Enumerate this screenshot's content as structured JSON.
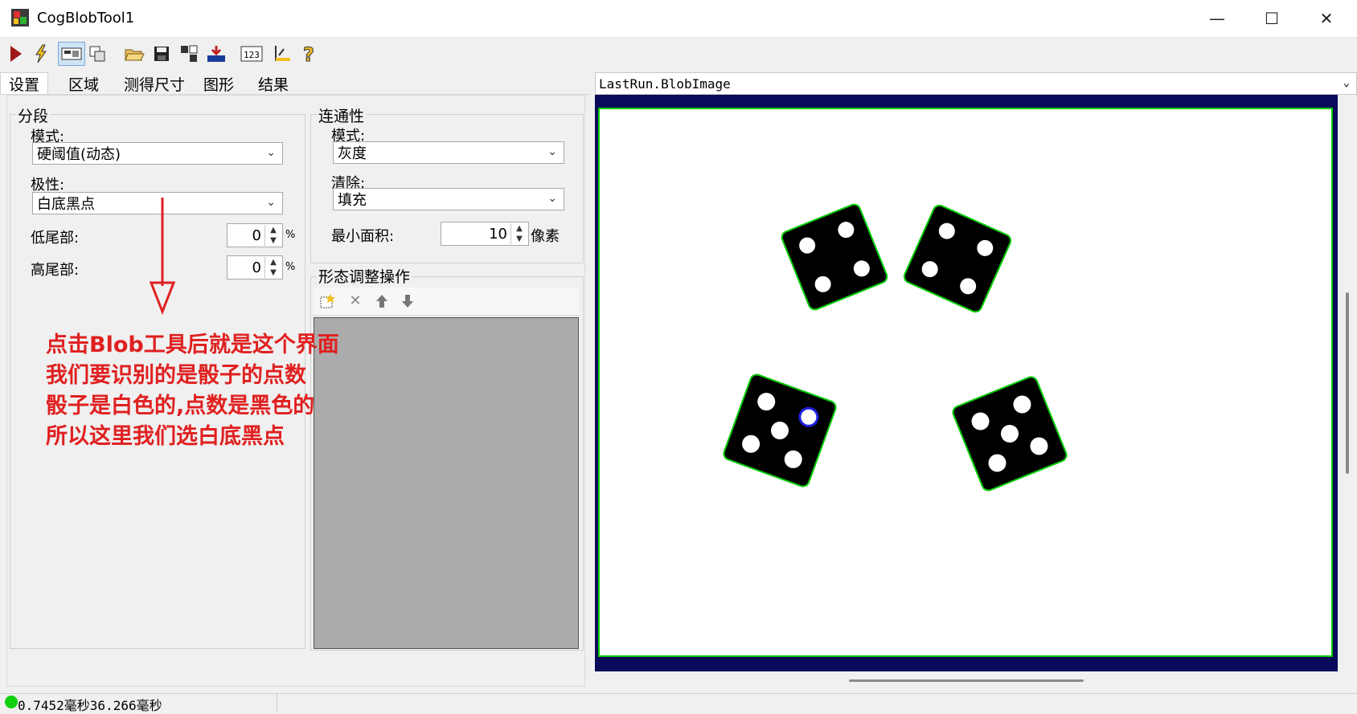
{
  "window": {
    "title": "CogBlobTool1"
  },
  "toolbar": {
    "buttons": [
      "run-icon",
      "electric-icon",
      "toggle-display-icon",
      "copy-image-icon",
      "open-folder-icon",
      "save-icon",
      "reset-icon",
      "load-icon",
      "number-icon",
      "measure-icon",
      "help-icon"
    ]
  },
  "tabs": [
    "设置",
    "区域",
    "测得尺寸",
    "图形",
    "结果"
  ],
  "segmentation": {
    "group_label": "分段",
    "mode_label": "模式:",
    "mode_value": "硬阈值(动态)",
    "polarity_label": "极性:",
    "polarity_value": "白底黑点",
    "low_tail_label": "低尾部:",
    "low_tail_value": "0",
    "high_tail_label": "高尾部:",
    "high_tail_value": "0",
    "percent": "%"
  },
  "connectivity": {
    "group_label": "连通性",
    "mode_label": "模式:",
    "mode_value": "灰度",
    "clean_label": "清除:",
    "clean_value": "填充",
    "min_area_label": "最小面积:",
    "min_area_value": "10",
    "unit": "像素"
  },
  "morphology": {
    "group_label": "形态调整操作"
  },
  "annotation": {
    "lines": [
      "点击Blob工具后就是这个界面",
      "我们要识别的是骰子的点数",
      "骰子是白色的,点数是黑色的",
      "所以这里我们选白底黑点"
    ]
  },
  "image_view": {
    "selector_value": "LastRun.BlobImage"
  },
  "status": {
    "text": "0.7452毫秒36.266毫秒"
  },
  "colors": {
    "annotation": "#e02020",
    "blob_outline": "#00cc00",
    "frame": "#0a0a5a"
  }
}
